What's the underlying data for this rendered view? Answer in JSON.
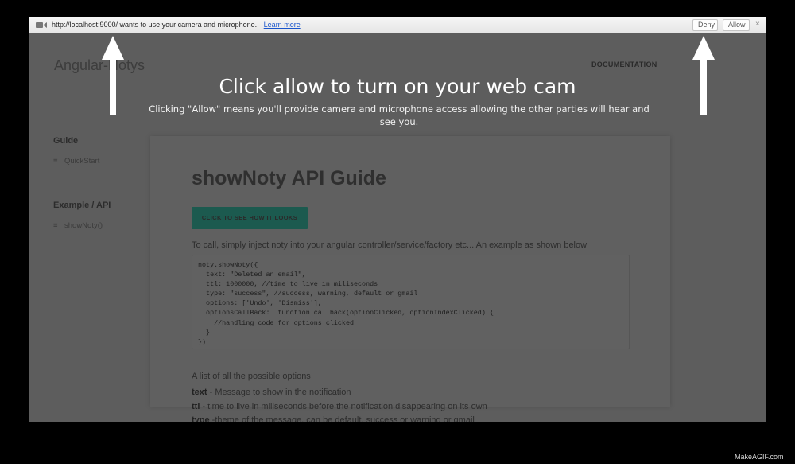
{
  "permission_bar": {
    "icon": "camera-icon",
    "message": "http://localhost:9000/ wants to use your camera and microphone.",
    "learn_more": "Learn more",
    "deny_label": "Deny",
    "allow_label": "Allow",
    "close_label": "×"
  },
  "site": {
    "brand": "Angular-Notys",
    "nav_documentation": "DOCUMENTATION"
  },
  "sidebar": {
    "sections": [
      {
        "heading": "Guide",
        "items": [
          "QuickStart"
        ]
      },
      {
        "heading": "Example / API",
        "items": [
          "showNoty()"
        ]
      }
    ],
    "bullet": "≡"
  },
  "main": {
    "title": "showNoty API Guide",
    "cta_button": "CLICK TO SEE HOW IT LOOKS",
    "intro": "To call, simply inject noty into your angular controller/service/factory etc... An example as shown below",
    "code": "noty.showNoty({\n  text: \"Deleted an email\",\n  ttl: 1000000, //time to live in miliseconds\n  type: \"success\", //success, warning, default or gmail\n  options: ['Undo', 'Dismiss'],\n  optionsCallBack:  function callback(optionClicked, optionIndexClicked) {\n    //handling code for options clicked\n  }\n})",
    "options_title": "A list of all the possible options",
    "options": [
      {
        "name": "text",
        "desc": " - Message to show in the notification"
      },
      {
        "name": "ttl",
        "desc": " - time to live in miliseconds before the notification disappearing on its own"
      },
      {
        "name": "type",
        "desc": " -theme of the message, can be default, success or warning or gmail"
      }
    ]
  },
  "overlay": {
    "title": "Click allow to turn on your web cam",
    "subtitle": "Clicking \"Allow\" means you'll provide camera and microphone access allowing the other parties will hear and see you."
  },
  "watermark": "MakeAGIF.com",
  "colors": {
    "accent_button": "#1c5a4f",
    "link": "#1a55cc",
    "overlay_text": "#ffffff"
  }
}
